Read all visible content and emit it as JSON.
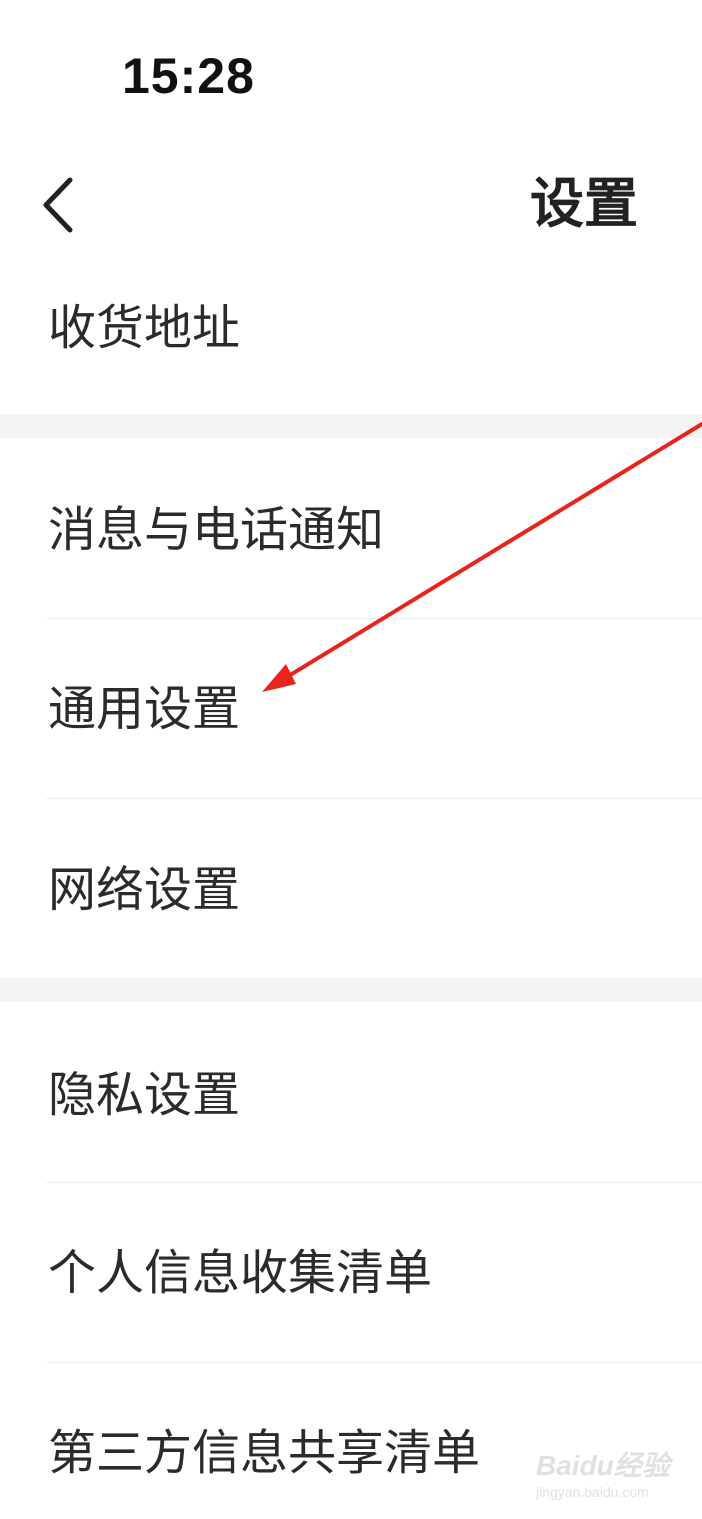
{
  "status_bar": {
    "time": "15:28"
  },
  "nav": {
    "back_icon": "chevron-left-icon",
    "title": "设置"
  },
  "menu": {
    "shipping_address": "收货地址",
    "message_phone_notify": "消息与电话通知",
    "general_settings": "通用设置",
    "network_settings": "网络设置",
    "privacy_settings": "隐私设置",
    "personal_info_list": "个人信息收集清单",
    "third_party_share_list": "第三方信息共享清单"
  },
  "annotation": {
    "arrow_color": "#e8241c"
  },
  "watermark": {
    "logo": "Baidu经验",
    "sub": "jingyan.baidu.com"
  },
  "colors": {
    "background": "#ffffff",
    "section_gap": "#f3f3f3",
    "divider": "#ececec",
    "text": "#2b2b2b"
  }
}
